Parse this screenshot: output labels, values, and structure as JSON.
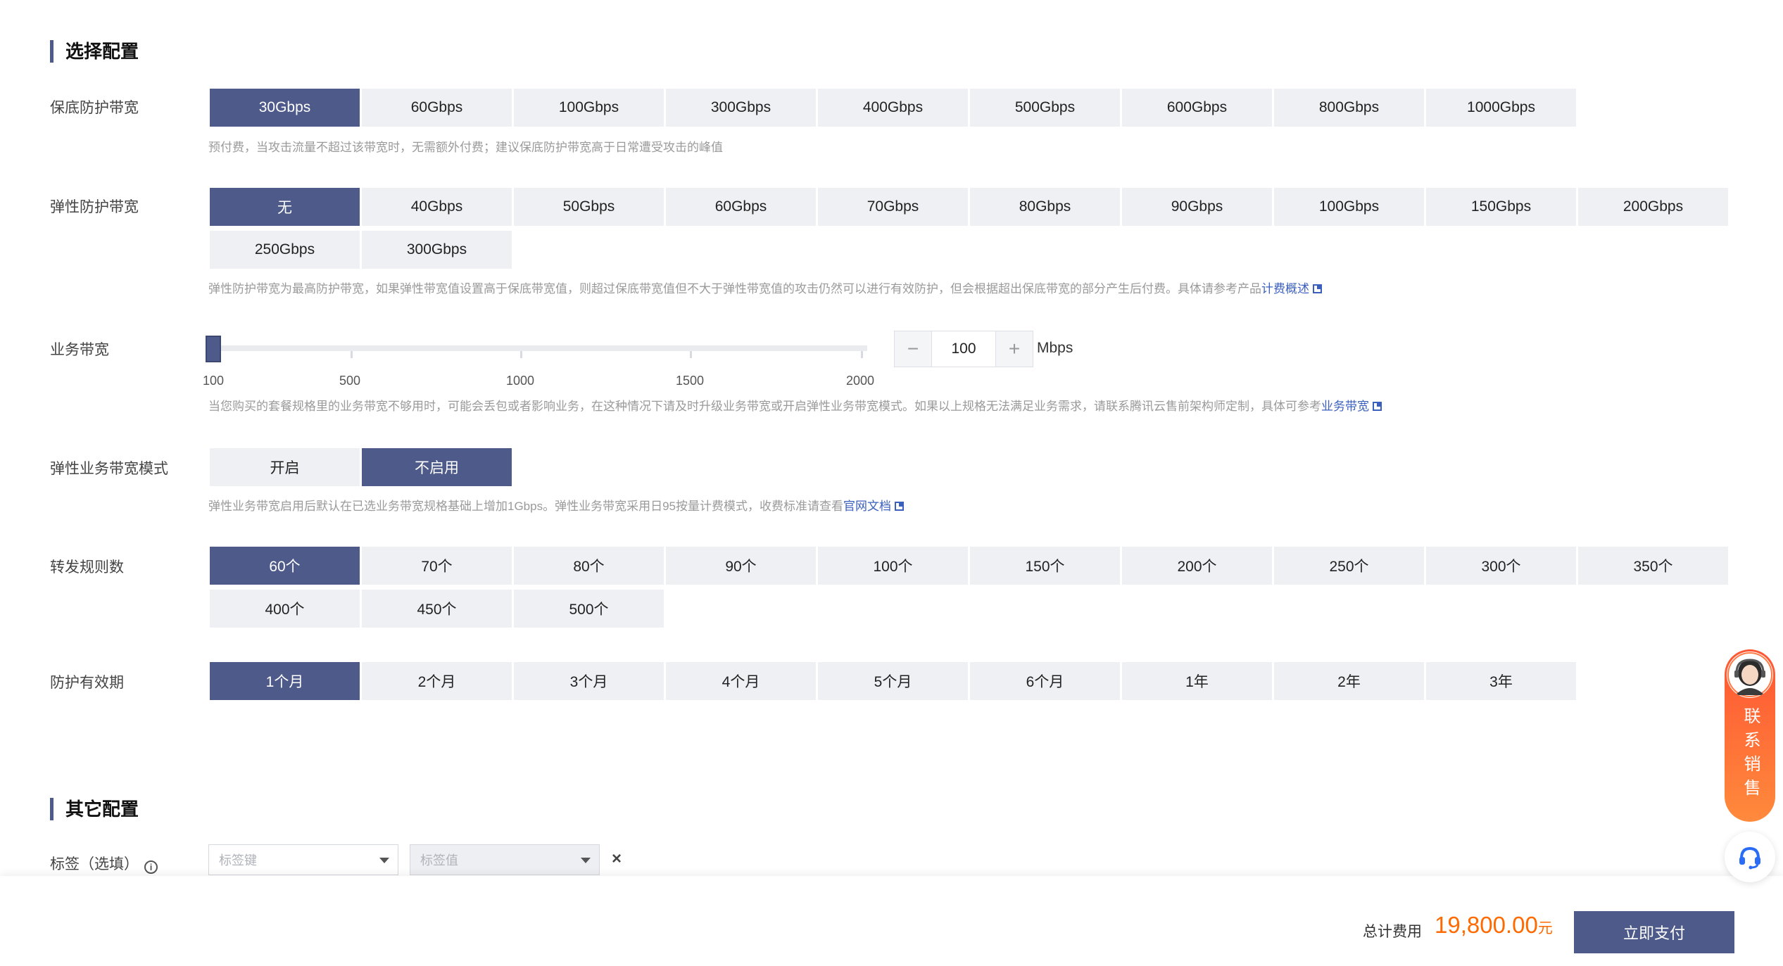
{
  "sections": {
    "select_config": "选择配置",
    "other_config": "其它配置"
  },
  "base_protection": {
    "label": "保底防护带宽",
    "options": [
      "30Gbps",
      "60Gbps",
      "100Gbps",
      "300Gbps",
      "400Gbps",
      "500Gbps",
      "600Gbps",
      "800Gbps",
      "1000Gbps"
    ],
    "selected": "30Gbps",
    "hint": "预付费，当攻击流量不超过该带宽时，无需额外付费；建议保底防护带宽高于日常遭受攻击的峰值"
  },
  "elastic_protection": {
    "label": "弹性防护带宽",
    "options": [
      "无",
      "40Gbps",
      "50Gbps",
      "60Gbps",
      "70Gbps",
      "80Gbps",
      "90Gbps",
      "100Gbps",
      "150Gbps",
      "200Gbps",
      "250Gbps",
      "300Gbps"
    ],
    "selected": "无",
    "hint": "弹性防护带宽为最高防护带宽，如果弹性带宽值设置高于保底带宽值，则超过保底带宽值但不大于弹性带宽值的攻击仍然可以进行有效防护，但会根据超出保底带宽的部分产生后付费。具体请参考产品",
    "hint_link": "计费概述"
  },
  "business_bandwidth": {
    "label": "业务带宽",
    "min": 100,
    "max": 2000,
    "value": 100,
    "ticks": [
      "100",
      "500",
      "1000",
      "1500",
      "2000"
    ],
    "value_text": "100",
    "minus": "−",
    "plus": "+",
    "unit": "Mbps",
    "hint": "当您购买的套餐规格里的业务带宽不够用时，可能会丢包或者影响业务，在这种情况下请及时升级业务带宽或开启弹性业务带宽模式。如果以上规格无法满足业务需求，请联系腾讯云售前架构师定制，具体可参考",
    "hint_link": "业务带宽"
  },
  "elastic_business_mode": {
    "label": "弹性业务带宽模式",
    "options": [
      "开启",
      "不启用"
    ],
    "selected": "不启用",
    "hint": "弹性业务带宽启用后默认在已选业务带宽规格基础上增加1Gbps。弹性业务带宽采用日95按量计费模式，收费标准请查看",
    "hint_link": "官网文档"
  },
  "forwarding_rules": {
    "label": "转发规则数",
    "options": [
      "60个",
      "70个",
      "80个",
      "90个",
      "100个",
      "150个",
      "200个",
      "250个",
      "300个",
      "350个",
      "400个",
      "450个",
      "500个"
    ],
    "selected": "60个"
  },
  "protection_period": {
    "label": "防护有效期",
    "options": [
      "1个月",
      "2个月",
      "3个月",
      "4个月",
      "5个月",
      "6个月",
      "1年",
      "2年",
      "3年"
    ],
    "selected": "1个月"
  },
  "tags": {
    "label": "标签（选填）",
    "key_placeholder": "标签键",
    "value_placeholder": "标签值",
    "remove": "×"
  },
  "footer": {
    "total_label": "总计费用",
    "total_amount": "19,800.00",
    "total_unit": "元",
    "pay_button": "立即支付"
  },
  "floating": {
    "contact_sales": "联系销售"
  },
  "colors": {
    "primary": "#4e5a8a",
    "option_bg": "#eef0f4",
    "price": "#ff6a00",
    "link": "#3a5fbd"
  },
  "icons": [
    "external-link-icon",
    "info-icon",
    "caret-down-icon",
    "close-icon",
    "headset-icon",
    "avatar"
  ]
}
